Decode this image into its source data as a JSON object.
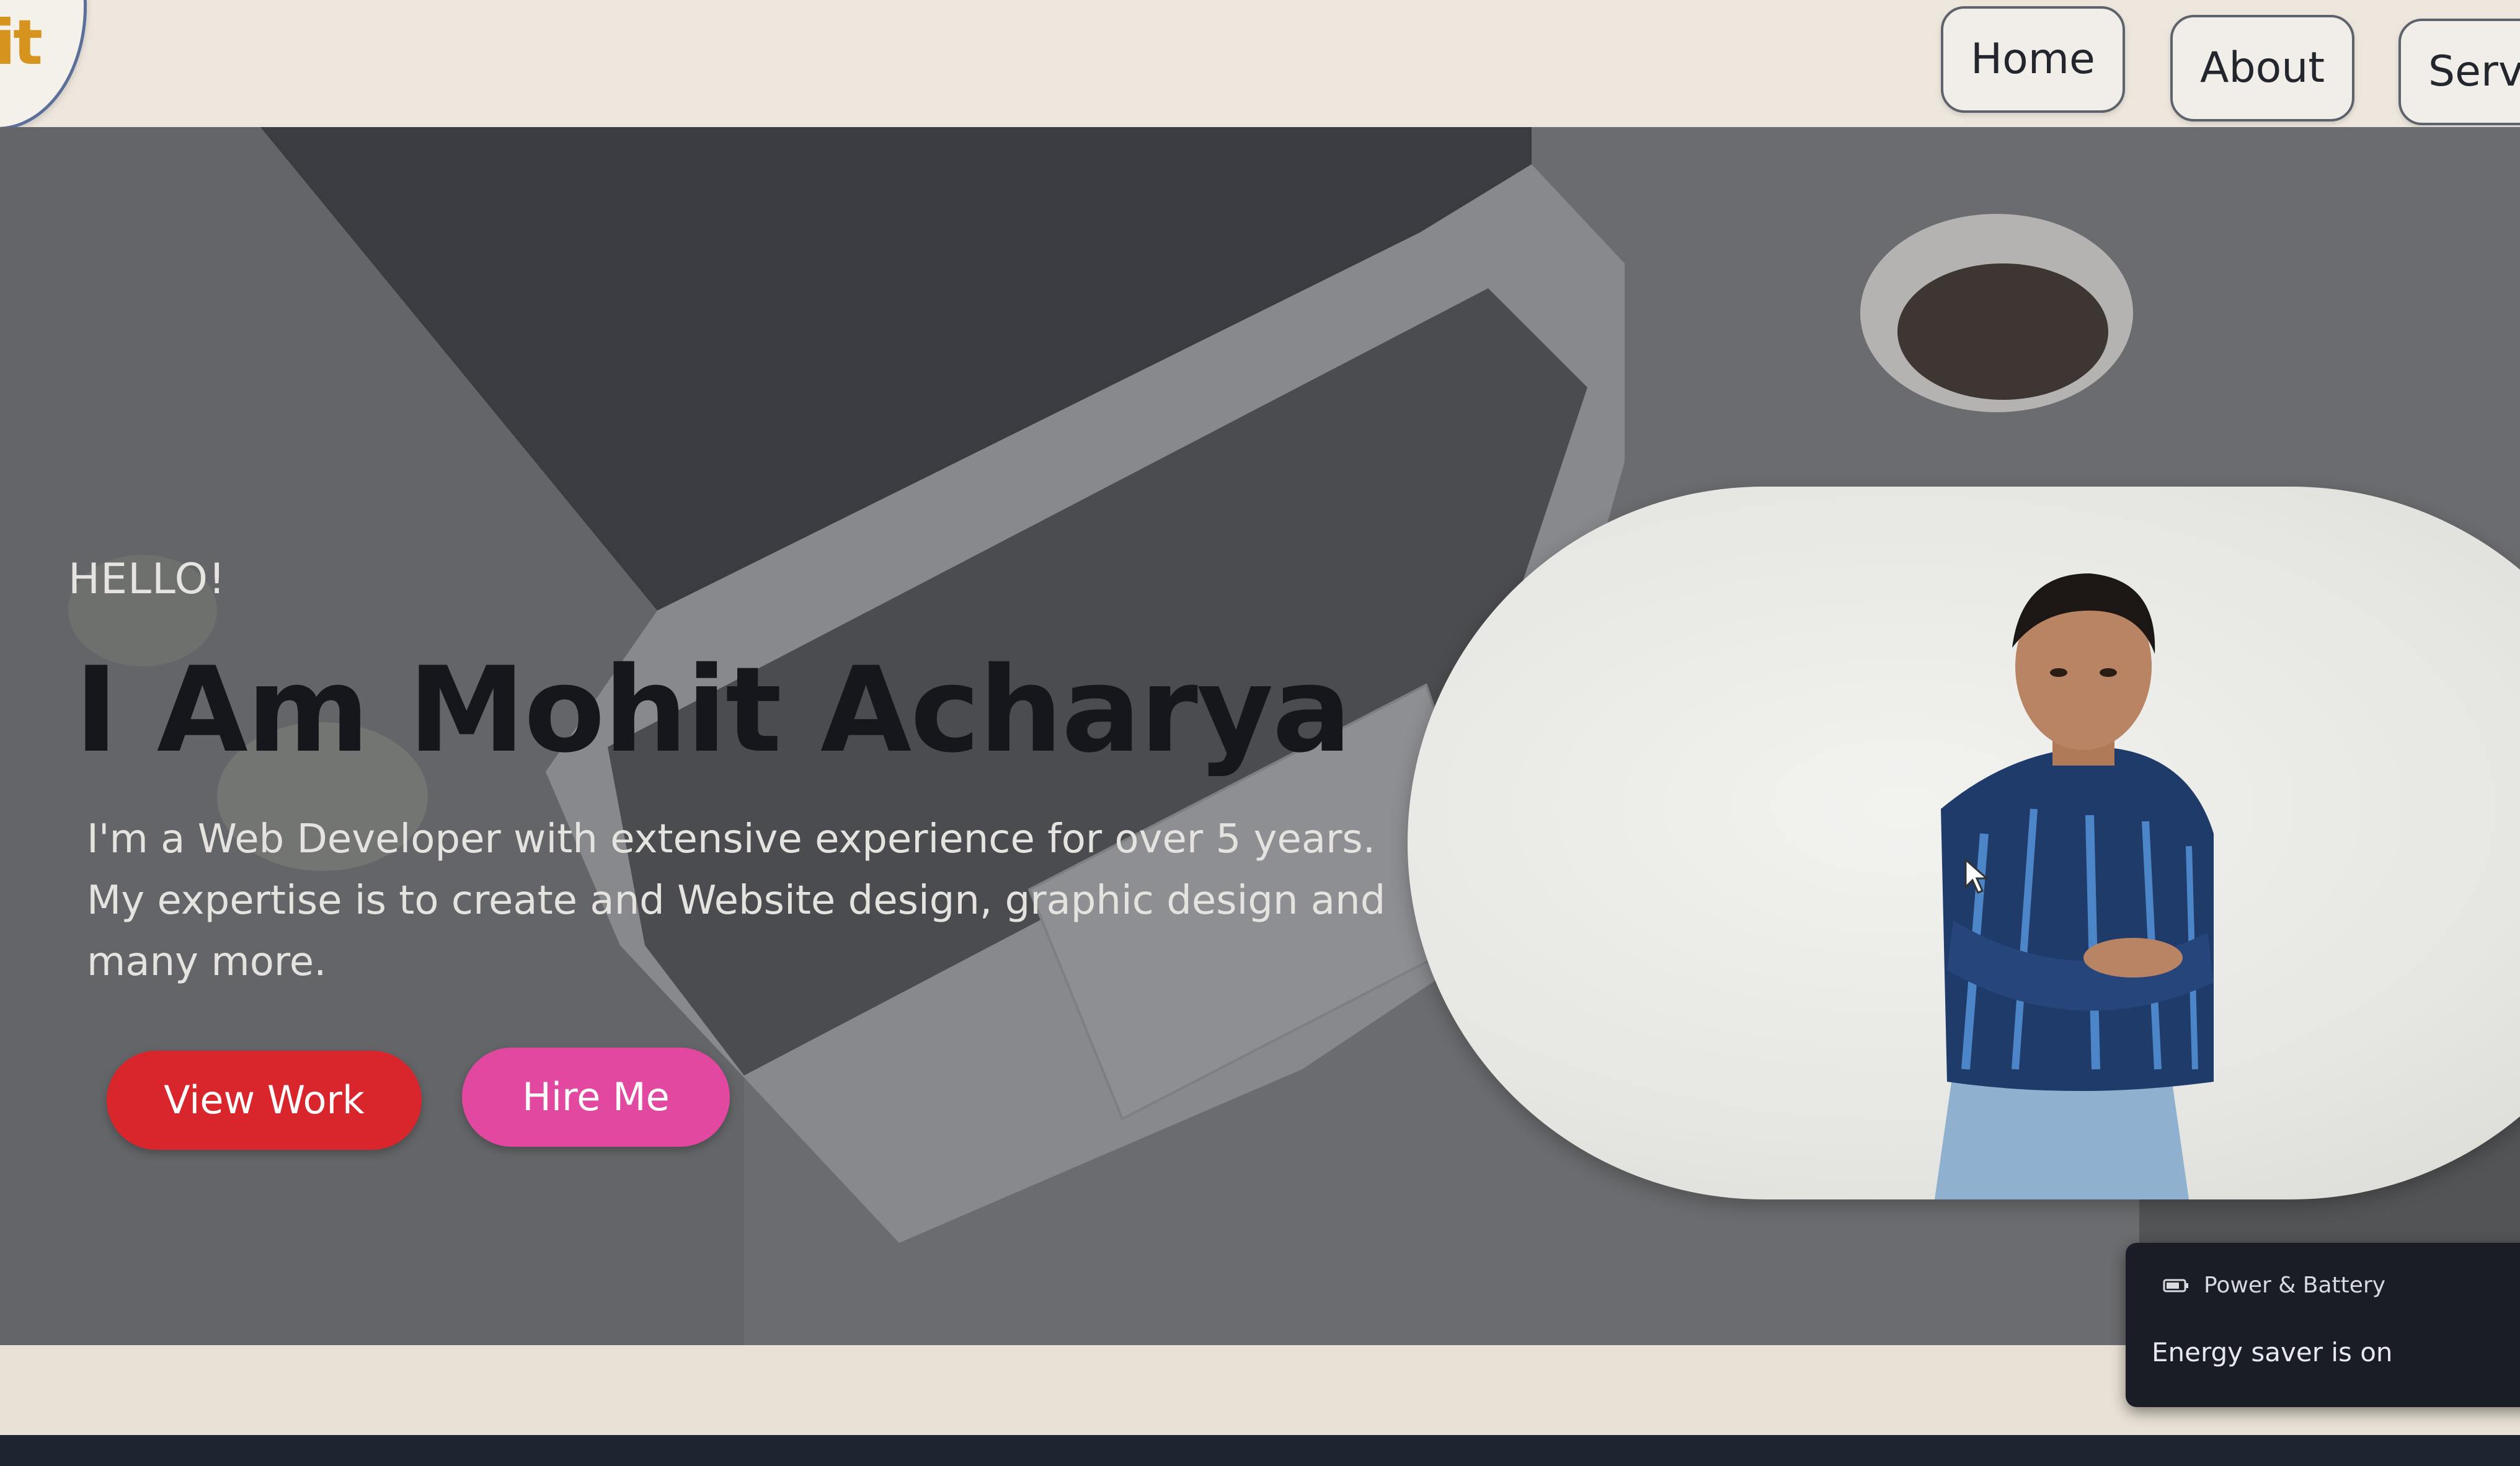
{
  "header": {
    "logo_text": "it",
    "nav": {
      "home": "Home",
      "about": "About",
      "services": "Servic"
    }
  },
  "hero": {
    "greeting": "HELLO!",
    "name": "I Am Mohit Acharya",
    "description": "I'm a Web Developer with extensive experience for over 5 years. My expertise is to create and Website design, graphic design and many more.",
    "buttons": {
      "view_work": "View Work",
      "hire_me": "Hire Me"
    }
  },
  "notification": {
    "title": "Power & Battery",
    "message": "Energy saver is on",
    "icon": "battery-icon"
  },
  "colors": {
    "view_work_button": "#d9262c",
    "hire_me_button": "#e2489f",
    "header_background": "#ece6dd",
    "name_text": "#15171c"
  }
}
